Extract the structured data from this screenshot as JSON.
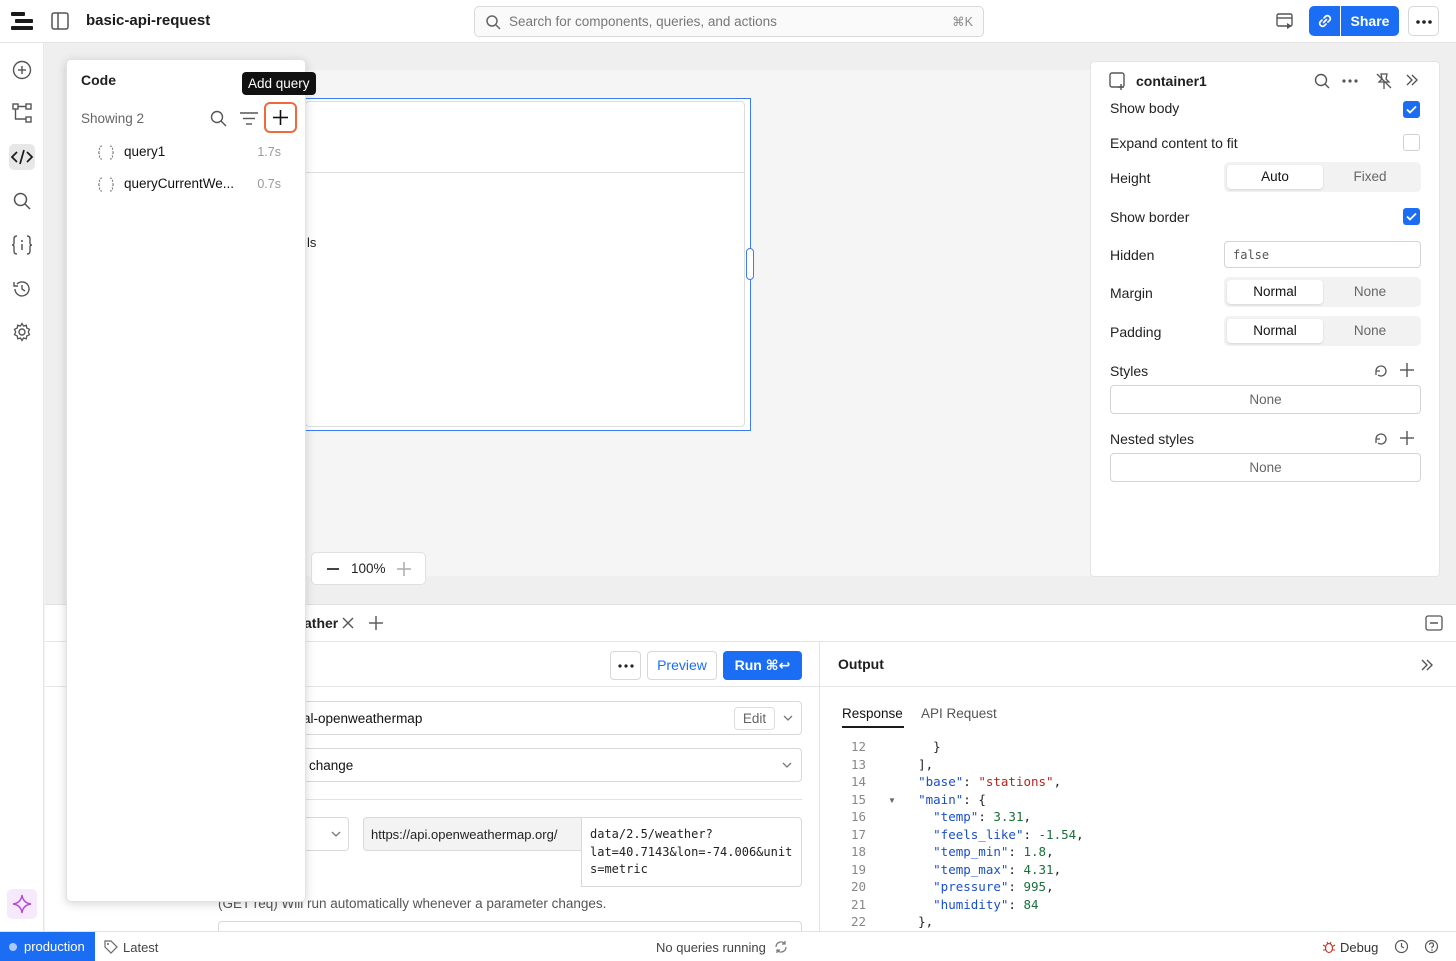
{
  "header": {
    "app_title": "basic-api-request",
    "search_placeholder": "Search for components, queries, and actions",
    "search_shortcut": "⌘K",
    "share_label": "Share"
  },
  "canvas": {
    "container_text": "ls",
    "zoom": "100%"
  },
  "code_panel": {
    "title": "Code",
    "showing": "Showing 2",
    "tooltip": "Add query",
    "queries": [
      {
        "name": "query1",
        "time": "1.7s"
      },
      {
        "name": "queryCurrentWe...",
        "time": "0.7s"
      }
    ]
  },
  "inspector": {
    "component_name": "container1",
    "show_body": "Show body",
    "expand_content": "Expand content to fit",
    "height_label": "Height",
    "height_options": [
      "Auto",
      "Fixed"
    ],
    "show_border": "Show border",
    "hidden_label": "Hidden",
    "hidden_value": "false",
    "margin_label": "Margin",
    "margin_options": [
      "Normal",
      "None"
    ],
    "padding_label": "Padding",
    "padding_options": [
      "Normal",
      "None"
    ],
    "styles_label": "Styles",
    "styles_value": "None",
    "nested_styles_label": "Nested styles",
    "nested_styles_value": "None"
  },
  "editor": {
    "tab_label": "ather",
    "preview_label": "Preview",
    "run_label": "Run ⌘↩",
    "resource_value": "al-openweathermap",
    "resource_edit": "Edit",
    "trigger_value": "change",
    "url_base": "https://api.openweathermap.org/",
    "url_path_lines": [
      "data/2.5/weather?",
      "lat=40.7143&lon=-74.006&unit",
      "s=metric"
    ],
    "auto_run_text": "(GET req) Will run automatically whenever a parameter changes."
  },
  "output": {
    "title": "Output",
    "tabs": [
      "Response",
      "API Request"
    ],
    "lines": [
      {
        "n": "12",
        "code": "      }"
      },
      {
        "n": "13",
        "code": "    ],"
      },
      {
        "n": "14",
        "code": "    \"base\": \"stations\","
      },
      {
        "n": "15",
        "code": "    \"main\": {"
      },
      {
        "n": "16",
        "code": "      \"temp\": 3.31,"
      },
      {
        "n": "17",
        "code": "      \"feels_like\": -1.54,"
      },
      {
        "n": "18",
        "code": "      \"temp_min\": 1.8,"
      },
      {
        "n": "19",
        "code": "      \"temp_max\": 4.31,"
      },
      {
        "n": "20",
        "code": "      \"pressure\": 995,"
      },
      {
        "n": "21",
        "code": "      \"humidity\": 84"
      },
      {
        "n": "22",
        "code": "    },"
      }
    ]
  },
  "status": {
    "environment": "production",
    "version": "Latest",
    "queries_status": "No queries running",
    "debug": "Debug"
  },
  "colors": {
    "accent": "#1b6ef3",
    "highlight": "#ef6a3a"
  }
}
